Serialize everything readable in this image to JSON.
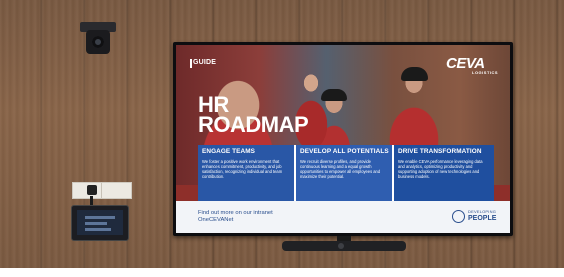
{
  "screen": {
    "badge": "GUIDE",
    "brand": {
      "name": "CEVA",
      "sub": "LOGISTICS"
    },
    "title": [
      "HR",
      "ROADMAP"
    ],
    "cards": [
      {
        "heading": "ENGAGE TEAMS",
        "body": "We foster a positive work environment that enhances commitment, productivity, and job satisfaction, recognizing individual and team contribution."
      },
      {
        "heading": "DEVELOP ALL POTENTIALS",
        "body": "We recruit diverse profiles, and provide continuous learning and a equal growth opportunities to empower all employees and maximize their potential."
      },
      {
        "heading": "DRIVE TRANSFORMATION",
        "body": "We enable CEVA performance leveraging data and analytics, optimizing productivity and supporting adoption of new technologies and business models."
      }
    ],
    "footer": {
      "text": "Find out more on our intranet OneCEVANet",
      "logo_top": "DEVELOPING",
      "logo_bottom": "PEOPLE"
    }
  },
  "colors": {
    "wall": "#7f5d44",
    "card_blue": "#2957a6",
    "footer_text": "#2b4f8e",
    "photo_red": "#b83333"
  },
  "icons": [
    "camera-icon",
    "power-outlet-icon",
    "control-panel-icon",
    "soundbar-icon",
    "ceva-logo-icon",
    "developing-people-logo-icon"
  ]
}
